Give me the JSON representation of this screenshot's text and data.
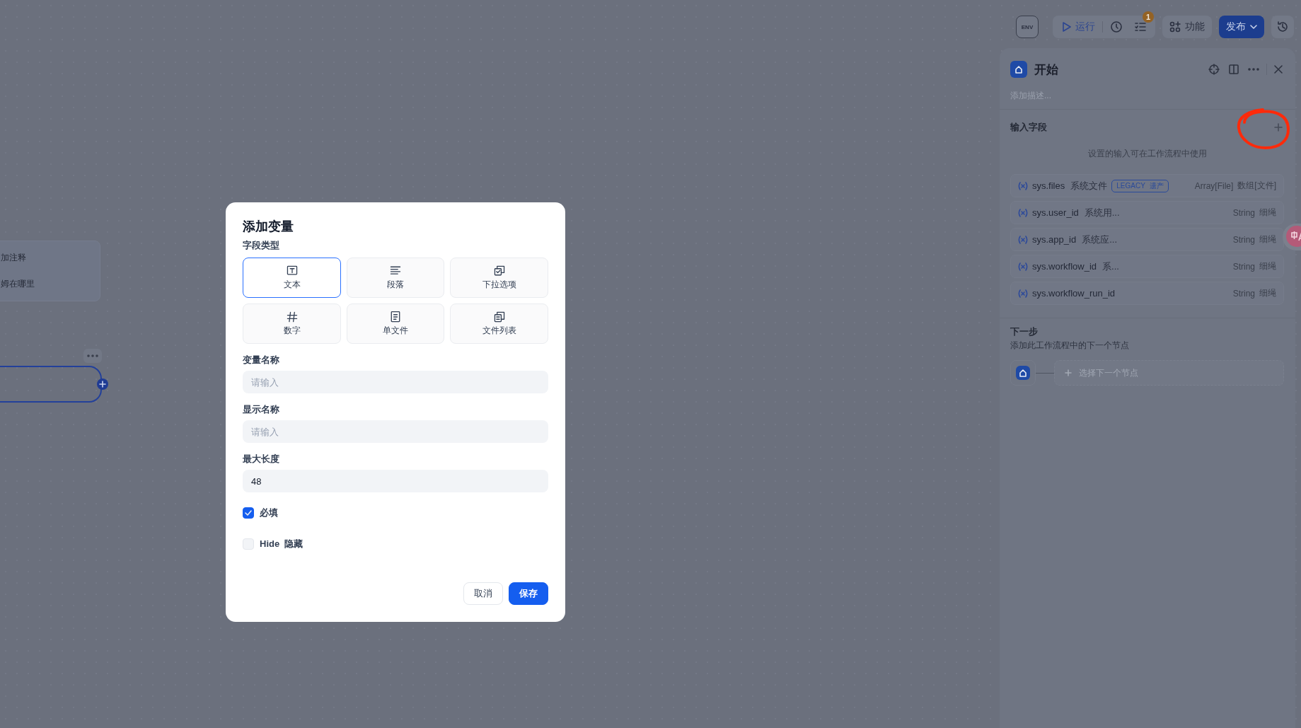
{
  "toolbar": {
    "env": "ENV",
    "run": "运行",
    "badge": "1",
    "features": "功能",
    "publish": "发布"
  },
  "canvas": {
    "note_lines": [
      "加注释",
      "姆在哪里"
    ]
  },
  "panel": {
    "title": "开始",
    "description_placeholder": "添加描述...",
    "input_title": "输入字段",
    "input_hint": "设置的输入可在工作流程中使用",
    "variables": [
      {
        "name": "sys.files",
        "label": "系统文件",
        "tag": "LEGACY",
        "tag_note": "遗产",
        "type": "Array[File]",
        "type_note": "数组[文件]"
      },
      {
        "name": "sys.user_id",
        "label": "系统用...",
        "type": "String",
        "type_note": "细绳"
      },
      {
        "name": "sys.app_id",
        "label": "系统应...",
        "type": "String",
        "type_note": "细绳"
      },
      {
        "name": "sys.workflow_id",
        "label": "系...",
        "type": "String",
        "type_note": "细绳"
      },
      {
        "name": "sys.workflow_run_id",
        "type": "String",
        "type_note": "细绳"
      }
    ],
    "next_title": "下一步",
    "next_description": "添加此工作流程中的下一个节点",
    "next_placeholder": "选择下一个节点"
  },
  "modal": {
    "title": "添加变量",
    "field_type_label": "字段类型",
    "field_types": [
      {
        "label": "文本",
        "kind": "text",
        "selected": true
      },
      {
        "label": "段落",
        "kind": "paragraph",
        "selected": false
      },
      {
        "label": "下拉选项",
        "kind": "select",
        "selected": false
      },
      {
        "label": "数字",
        "kind": "number",
        "selected": false
      },
      {
        "label": "单文件",
        "kind": "file",
        "selected": false
      },
      {
        "label": "文件列表",
        "kind": "file-list",
        "selected": false
      }
    ],
    "fields": [
      {
        "label": "变量名称",
        "placeholder": "请输入"
      },
      {
        "label": "显示名称",
        "placeholder": "请输入"
      },
      {
        "label": "最大长度",
        "value": "48"
      }
    ],
    "checkboxes": [
      {
        "label": "必填",
        "checked": true
      },
      {
        "label": "Hide  隐藏",
        "checked": false
      }
    ],
    "buttons": [
      {
        "label": "取消",
        "kind": "secondary"
      },
      {
        "label": "保存",
        "kind": "primary"
      }
    ]
  }
}
